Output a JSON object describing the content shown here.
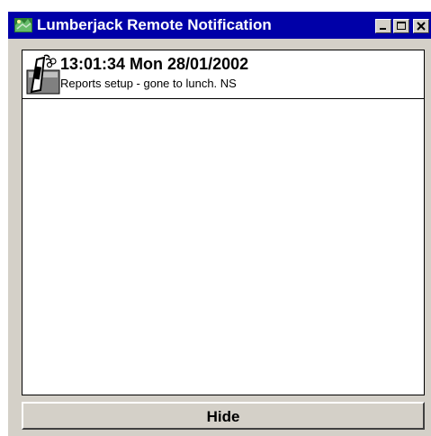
{
  "window": {
    "title": "Lumberjack Remote Notification",
    "titlebar_color": "#0000a8",
    "face_color": "#d4d0c8",
    "app_icon": "lumberjack-app-icon",
    "controls": {
      "minimize_icon": "minimize-icon",
      "maximize_icon": "maximize-icon",
      "close_icon": "close-icon"
    }
  },
  "notifications": [
    {
      "icon": "pager-phone-icon",
      "timestamp": "13:01:34 Mon 28/01/2002",
      "message": "Reports setup - gone to lunch. NS"
    }
  ],
  "footer": {
    "hide_label": "Hide"
  }
}
